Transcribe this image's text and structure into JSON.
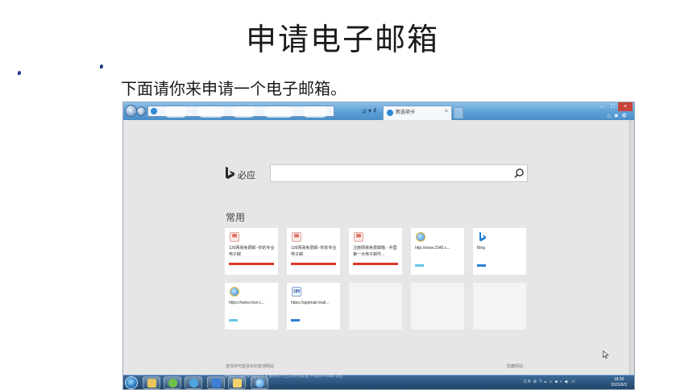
{
  "slide": {
    "title": "申请电子邮箱",
    "subtitle": "下面请你来申请一个电子邮箱。"
  },
  "browser": {
    "address_tools": "ρ ▾ ¢",
    "tab_title": "新选项卡",
    "tab_close": "×",
    "window_controls": [
      "–",
      "□",
      "×"
    ],
    "toolbar_icons": [
      "home-icon",
      "favorites-star-icon",
      "settings-gear-icon"
    ]
  },
  "newtab": {
    "bing_name": "必应",
    "section_title": "常用",
    "tiles": [
      {
        "text": "126网易免费邮--你的专业电子邮",
        "icon": "mail-icon",
        "bar": "red"
      },
      {
        "text": "126网易免费邮--你的专业电子邮",
        "icon": "mail-icon",
        "bar": "red"
      },
      {
        "text": "注册网易免费邮箱 - 中国第一大电子邮件...",
        "icon": "mail-icon",
        "bar": "red"
      },
      {
        "text": "http://www.2345.c...",
        "icon": "ie-icon",
        "bar": "cyan"
      },
      {
        "text": "Bing",
        "icon": "bing-icon",
        "bar": "blue"
      },
      {
        "text": "https://www.msn.c...",
        "icon": "ie-icon",
        "bar": "cyan"
      },
      {
        "text": "https://appmail.mail...",
        "icon": "app-icon",
        "bar": "blue"
      }
    ],
    "footer_left": "查找你可能喜欢的其他网站",
    "footer_right": "隐藏网站",
    "taskbar_strip": "重新打开关闭的选项卡 ▾    重新打开上次浏览会话    开始InPrivate 浏览"
  },
  "taskbar": {
    "tray": "CH ⚙ ? ▴ ♫ ■ ▪ ◀ .ıl",
    "time": "18:26",
    "date": "2021/6/3"
  }
}
